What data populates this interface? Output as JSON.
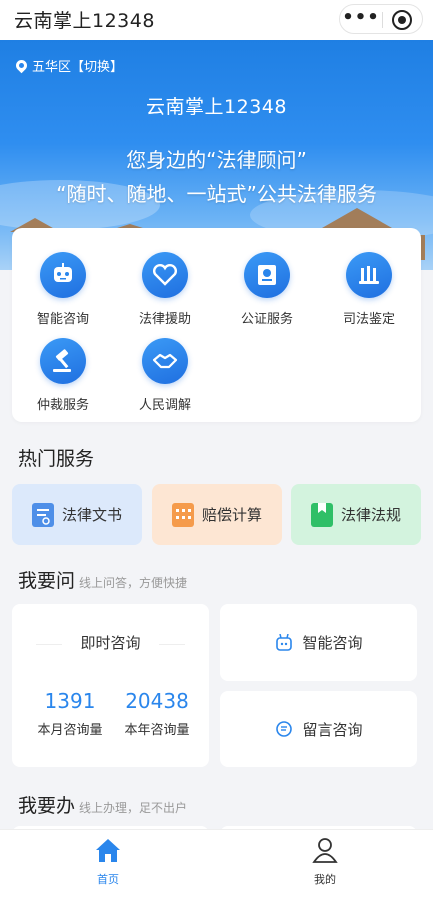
{
  "app": {
    "title": "云南掌上12348"
  },
  "banner": {
    "location": "五华区【切换】",
    "title": "云南掌上12348",
    "slogan_line1": "您身边的“法律顾问”",
    "slogan_line2": "“随时、随地、一站式”公共法律服务"
  },
  "services": [
    {
      "label": "智能咨询",
      "icon": "robot-icon"
    },
    {
      "label": "法律援助",
      "icon": "heart-icon"
    },
    {
      "label": "公证服务",
      "icon": "notary-seal-icon"
    },
    {
      "label": "司法鉴定",
      "icon": "lab-flask-icon"
    },
    {
      "label": "仲裁服务",
      "icon": "gavel-icon"
    },
    {
      "label": "人民调解",
      "icon": "handshake-icon"
    }
  ],
  "hot_services": {
    "title": "热门服务",
    "items": [
      {
        "label": "法律文书",
        "icon": "document-icon",
        "bg": "#dce9fb",
        "icon_color": "#4e8fe8"
      },
      {
        "label": "赔偿计算",
        "icon": "calculator-icon",
        "bg": "#fde6d3",
        "icon_color": "#f59b4b"
      },
      {
        "label": "法律法规",
        "icon": "book-icon",
        "bg": "#d3f3de",
        "icon_color": "#2fbf67"
      }
    ]
  },
  "ask": {
    "title": "我要问",
    "subtitle": "线上问答，方便快捷",
    "instant": {
      "title": "即时咨询",
      "month_count": "1391",
      "month_label": "本月咨询量",
      "year_count": "20438",
      "year_label": "本年咨询量"
    },
    "smart_label": "智能咨询",
    "message_label": "留言咨询"
  },
  "do": {
    "title": "我要办",
    "subtitle": "线上办理，足不出户"
  },
  "tabbar": {
    "home": "首页",
    "mine": "我的",
    "active_color": "#2a86ec"
  },
  "colors": {
    "accent": "#2a86ec",
    "banner_top": "#1f7fe3"
  }
}
